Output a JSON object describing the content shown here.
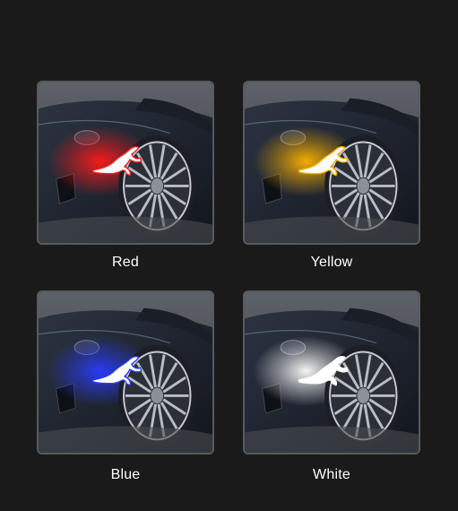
{
  "variants": [
    {
      "label": "Red",
      "glow_color": "#ff1a1a"
    },
    {
      "label": "Yellow",
      "glow_color": "#ffb300"
    },
    {
      "label": "Blue",
      "glow_color": "#2a3cff"
    },
    {
      "label": "White",
      "glow_color": "#ffffff"
    }
  ],
  "icons": {
    "car": "car-illustration",
    "gecko": "gecko-decal-icon"
  }
}
